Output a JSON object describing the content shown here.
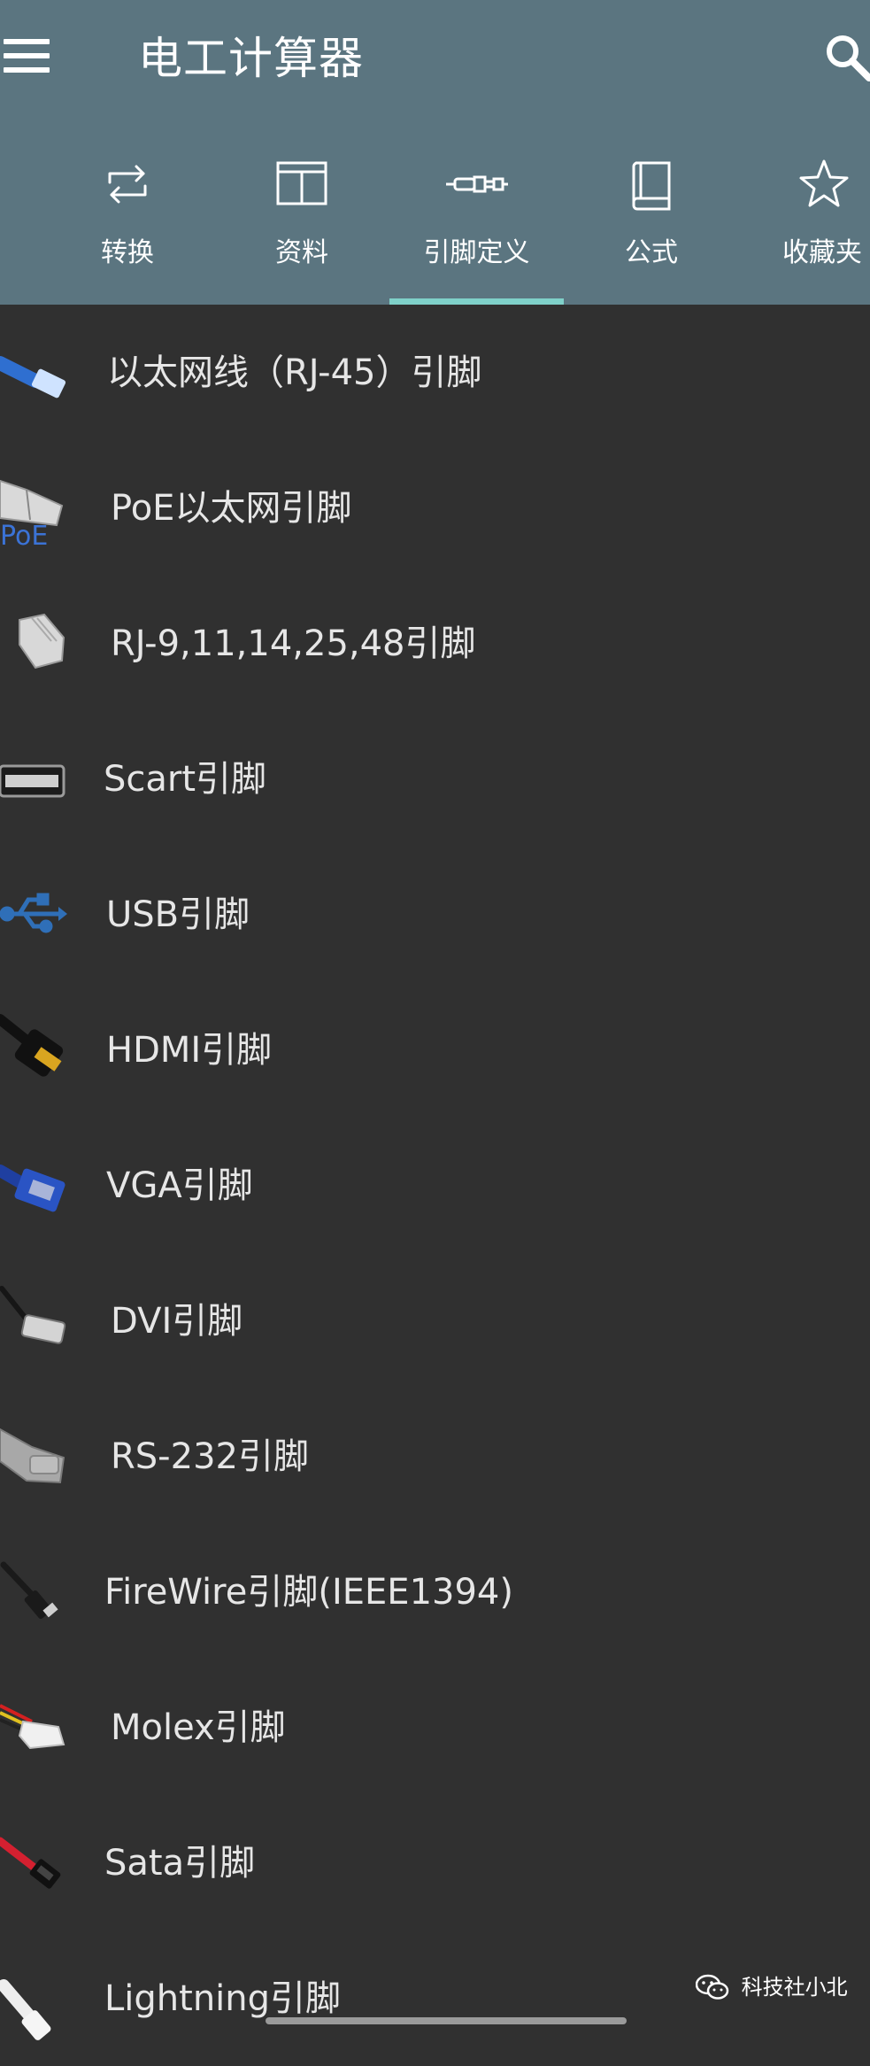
{
  "app": {
    "title": "电工计算器"
  },
  "colors": {
    "appbar": "#5b7580",
    "indicator": "#7fd1c9",
    "background": "#303030",
    "text": "#e6e6e6"
  },
  "tabs": [
    {
      "label": "转换",
      "icon": "repeat-icon"
    },
    {
      "label": "资料",
      "icon": "table-icon"
    },
    {
      "label": "引脚定义",
      "icon": "connector-icon",
      "selected": true
    },
    {
      "label": "公式",
      "icon": "book-icon"
    },
    {
      "label": "收藏夹",
      "icon": "star-icon"
    }
  ],
  "items": [
    {
      "label": "以太网线（RJ-45）引脚",
      "icon": "rj45-cable-icon"
    },
    {
      "label": "PoE以太网引脚",
      "icon": "poe-plug-icon"
    },
    {
      "label": "RJ-9,11,14,25,48引脚",
      "icon": "rj-plug-icon"
    },
    {
      "label": "Scart引脚",
      "icon": "scart-plug-icon"
    },
    {
      "label": "USB引脚",
      "icon": "usb-symbol-icon"
    },
    {
      "label": "HDMI引脚",
      "icon": "hdmi-plug-icon"
    },
    {
      "label": "VGA引脚",
      "icon": "vga-plug-icon"
    },
    {
      "label": "DVI引脚",
      "icon": "dvi-plug-icon"
    },
    {
      "label": "RS-232引脚",
      "icon": "rs232-plug-icon"
    },
    {
      "label": "FireWire引脚(IEEE1394)",
      "icon": "firewire-plug-icon"
    },
    {
      "label": "Molex引脚",
      "icon": "molex-plug-icon"
    },
    {
      "label": "Sata引脚",
      "icon": "sata-plug-icon"
    },
    {
      "label": "Lightning引脚",
      "icon": "lightning-plug-icon"
    }
  ],
  "watermark": {
    "text": "科技社小北",
    "icon": "wechat-icon"
  }
}
